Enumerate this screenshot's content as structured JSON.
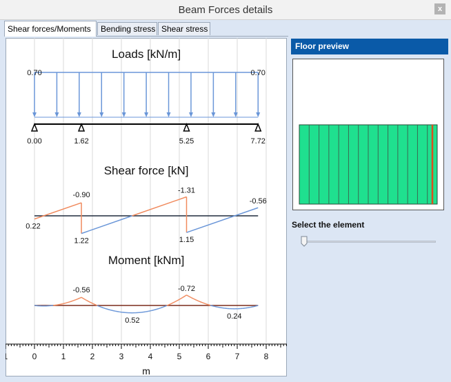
{
  "window": {
    "title": "Beam Forces details",
    "close_label": "x"
  },
  "tabs": [
    {
      "label": "Shear forces/Moments",
      "active": true
    },
    {
      "label": "Bending stress",
      "active": false
    },
    {
      "label": "Shear stress",
      "active": false
    }
  ],
  "chart_data": {
    "type": "line",
    "x_axis": {
      "label": "m",
      "range": [
        -1,
        8.8
      ],
      "ticks": [
        1,
        0,
        1,
        2,
        3,
        4,
        5,
        6,
        7,
        8
      ]
    },
    "grid": true,
    "supports_x": [
      0.0,
      1.62,
      5.25,
      7.72
    ],
    "support_labels": [
      "0.00",
      "1.62",
      "5.25",
      "7.72"
    ],
    "loads": {
      "title": "Loads [kN/m]",
      "value_start": "0.70",
      "value_end": "0.70",
      "arrow_x": [
        0,
        0.772,
        1.544,
        2.316,
        3.088,
        3.86,
        4.632,
        5.404,
        6.176,
        6.948,
        7.72
      ]
    },
    "shear": {
      "title": "Shear force [kN]",
      "segments": [
        {
          "x": [
            0,
            1.62
          ],
          "y": [
            0.22,
            -0.9
          ],
          "color": "#f08a5d"
        },
        {
          "x": [
            1.62,
            5.25
          ],
          "y": [
            1.22,
            -1.31
          ],
          "color_pos": "#6a96d8",
          "color_neg": "#f08a5d"
        },
        {
          "x": [
            5.25,
            7.72
          ],
          "y": [
            1.15,
            -0.56
          ],
          "color": "#6a96d8"
        }
      ],
      "labels": [
        {
          "text": "0.22",
          "x": 0,
          "y": 0.22
        },
        {
          "text": "-0.90",
          "x": 1.62,
          "y": -0.9
        },
        {
          "text": "1.22",
          "x": 1.62,
          "y": 1.22
        },
        {
          "text": "-1.31",
          "x": 5.25,
          "y": -1.31
        },
        {
          "text": "1.15",
          "x": 5.25,
          "y": 1.15
        },
        {
          "text": "-0.56",
          "x": 7.72,
          "y": -0.56
        }
      ]
    },
    "moment": {
      "title": "Moment [kNm]",
      "labels": [
        {
          "text": "-0.56",
          "x": 1.62,
          "y": -0.56
        },
        {
          "text": "0.52",
          "x": 3.38,
          "y": 0.52
        },
        {
          "text": "-0.72",
          "x": 5.25,
          "y": -0.72
        },
        {
          "text": "0.24",
          "x": 6.9,
          "y": 0.24
        }
      ]
    },
    "colors": {
      "positive": "#6a96d8",
      "negative": "#f08a5d",
      "baseline": "#7a2a1a",
      "grid": "#d9d9d9"
    }
  },
  "panel": {
    "title": "Floor preview",
    "select_label": "Select the element",
    "floor": {
      "strip_count": 14,
      "fill": "#1fe08f",
      "highlight": "#d9501e",
      "slider_value": 0
    }
  }
}
